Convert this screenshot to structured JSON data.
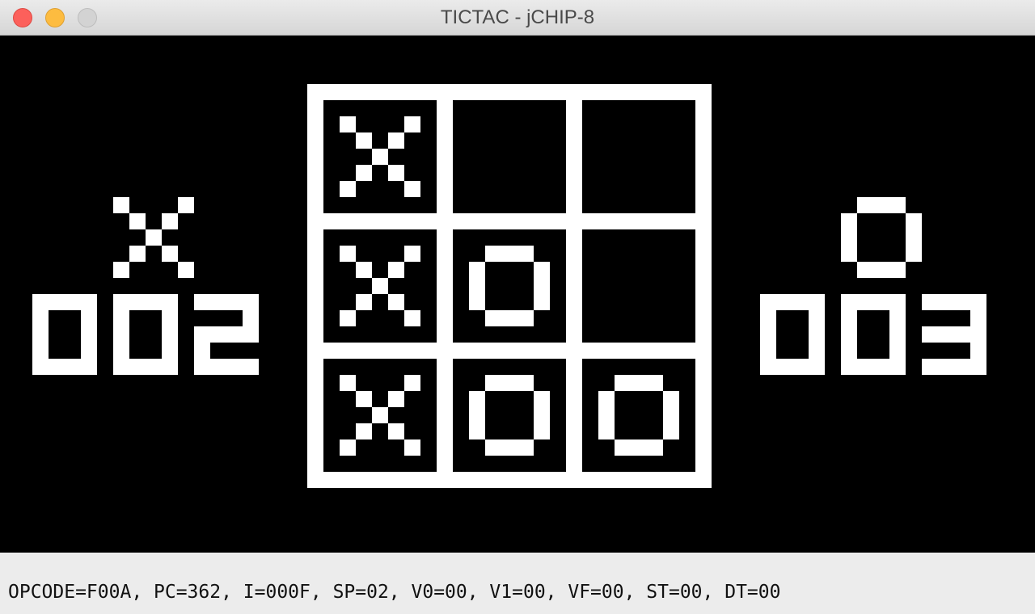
{
  "window": {
    "title": "TICTAC - jCHIP-8",
    "controls": [
      "close",
      "minimize",
      "maximize"
    ]
  },
  "game": {
    "board": [
      [
        "X",
        "",
        ""
      ],
      [
        "X",
        "O",
        ""
      ],
      [
        "X",
        "O",
        "O"
      ]
    ],
    "player_x": {
      "symbol": "X",
      "score": "002"
    },
    "player_o": {
      "symbol": "O",
      "score": "003"
    }
  },
  "status": {
    "text": "OPCODE=F00A, PC=362, I=000F, SP=02, V0=00, V1=00, VF=00, ST=00, DT=00"
  },
  "colors": {
    "pixel_on": "#ffffff",
    "pixel_off": "#000000",
    "close": "#fc605b",
    "minimize": "#fdbc40",
    "maximize": "#d3d3d3"
  }
}
